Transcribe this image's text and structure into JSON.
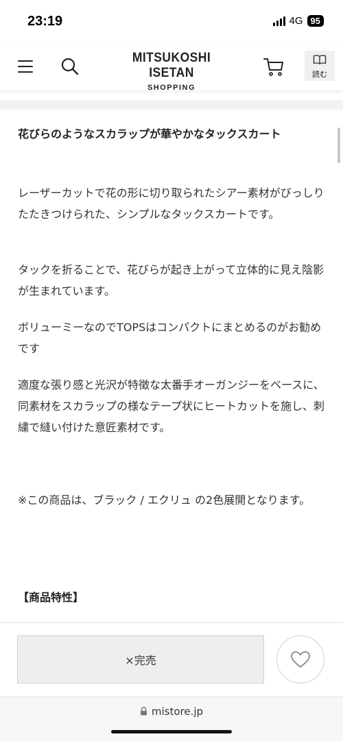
{
  "status_bar": {
    "time": "23:19",
    "network": "4G",
    "battery": "95"
  },
  "header": {
    "brand_title": "MITSUKOSHI ISETAN",
    "brand_subtitle": "SHOPPING",
    "read_label": "読む",
    "icons": [
      "menu-icon",
      "search-icon",
      "cart-icon",
      "book-icon"
    ]
  },
  "product": {
    "heading": "花びらのようなスカラップが華やかなタックスカート",
    "paragraphs": [
      "レーザーカットで花の形に切り取られたシアー素材がびっしりたたきつけられた、シンプルなタックスカートです。",
      "タックを折ることで、花びらが起き上がって立体的に見え陰影が生まれています。",
      "ボリューミーなのでTOPSはコンパクトにまとめるのがお勧めです",
      "適度な張り感と光沢が特徴な太番手オーガンジーをベースに、同素材をスカラップの様なテープ状にヒートカットを施し、刺繍で縫い付けた意匠素材です。",
      "※この商品は、ブラック / エクリュ の2色展開となります。"
    ],
    "features_title": "【商品特性】"
  },
  "actions": {
    "soldout_label": "×完売",
    "favorite_icon": "heart-icon"
  },
  "browser": {
    "url": "mistore.jp"
  }
}
